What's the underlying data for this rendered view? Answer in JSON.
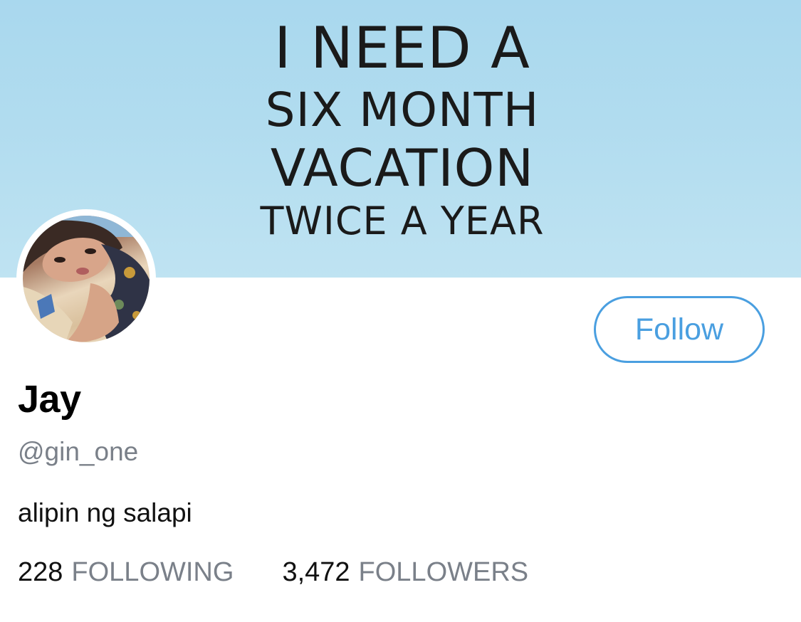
{
  "banner": {
    "lines": [
      "I NEED A",
      "SIX MONTH",
      "VACATION",
      "TWICE A YEAR"
    ],
    "background_color": "#b1dcef"
  },
  "profile": {
    "display_name": "Jay",
    "handle": "@gin_one",
    "bio": "alipin ng salapi"
  },
  "actions": {
    "follow_label": "Follow"
  },
  "stats": {
    "following_count": "228",
    "following_label": "FOLLOWING",
    "followers_count": "3,472",
    "followers_label": "FOLLOWERS"
  },
  "colors": {
    "accent": "#4a9fe0",
    "secondary_text": "#7a8089"
  }
}
